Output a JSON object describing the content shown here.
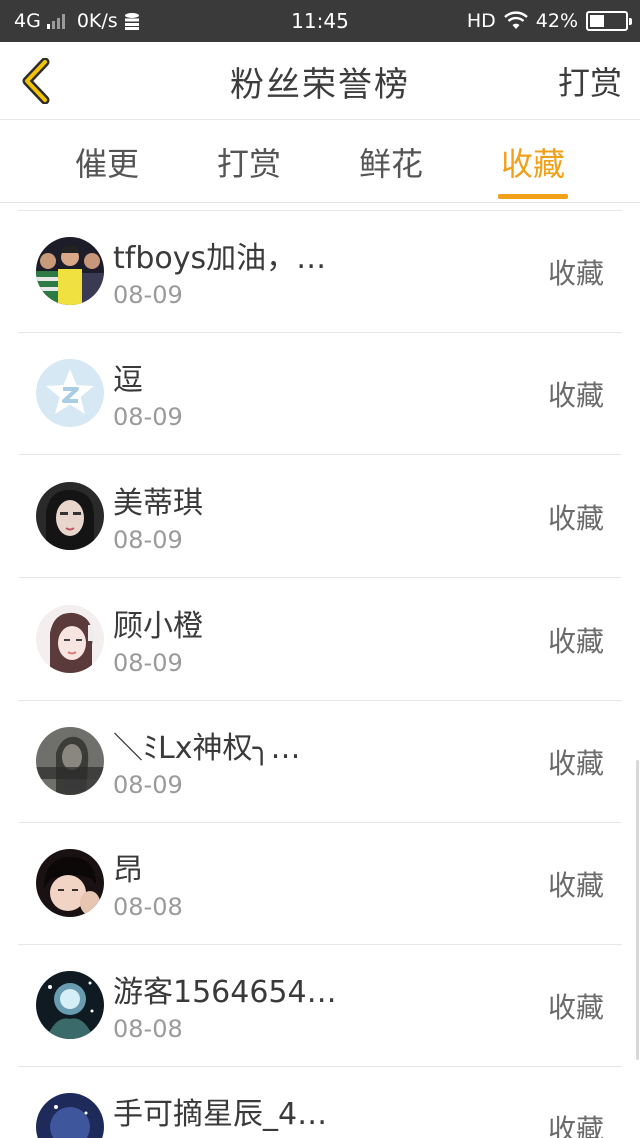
{
  "status_bar": {
    "network": "4G",
    "speed": "0K/s",
    "time": "11:45",
    "hd": "HD",
    "battery": "42%",
    "battery_level": 0.42
  },
  "header": {
    "title": "粉丝荣誉榜",
    "action": "打赏"
  },
  "tabs": [
    "催更",
    "打赏",
    "鲜花",
    "收藏"
  ],
  "active_tab": "收藏",
  "accent_color": "#f0a019",
  "rows": [
    {
      "name": "tfboys加油，…",
      "date": "08-09",
      "action": "收藏"
    },
    {
      "name": "逗",
      "date": "08-09",
      "action": "收藏"
    },
    {
      "name": "美蒂琪",
      "date": "08-09",
      "action": "收藏"
    },
    {
      "name": "顾小橙",
      "date": "08-09",
      "action": "收藏"
    },
    {
      "name": "＼ﾐLx神权╮…",
      "date": "08-09",
      "action": "收藏"
    },
    {
      "name": "昂",
      "date": "08-08",
      "action": "收藏"
    },
    {
      "name": "游客1564654…",
      "date": "08-08",
      "action": "收藏"
    },
    {
      "name": "手可摘星辰_4…",
      "date": "",
      "action": "收藏"
    }
  ]
}
